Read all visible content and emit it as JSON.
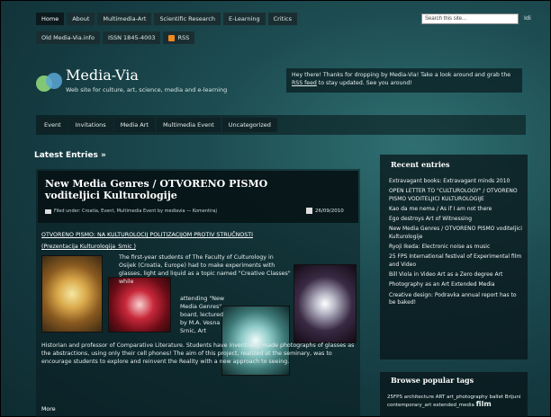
{
  "topnav": [
    "Home",
    "About",
    "Multimedia-Art",
    "Scientific Research",
    "E-Learning",
    "Critics"
  ],
  "subnav": {
    "items": [
      "Old Media-Via.info",
      "ISSN 1845-4003"
    ],
    "rss": "RSS"
  },
  "search": {
    "placeholder": "Search this site...",
    "go": "Idi"
  },
  "header": {
    "title": "Media-Via",
    "description": "Web site for culture, art, science, media and e-learning",
    "welcome_before": "Hey there! Thanks for dropping by Media-Via! Take a look around and grab the ",
    "welcome_link": "RSS feed",
    "welcome_after": " to stay updated. See you around!"
  },
  "catnav": [
    "Event",
    "Invitations",
    "Media Art",
    "Multimedia Event",
    "Uncategorized"
  ],
  "main": {
    "heading": "Latest Entries »",
    "post": {
      "title": "New Media Genres / OTVORENO PISMO voditeljici Kulturologije",
      "filed": "Filed under: Croatia, Event, Multimedia Event by mediavia — Komentiraj",
      "date": "26/09/2010",
      "subtitle1": "OTVORENO PISMO: NA KULTUROLOCIJ POLITIZACIJOM PROTIV STRUČNOSTI",
      "subtitle2": "(Prezentacija Kulturologija_Smic )",
      "para1": "The first-year students of The Faculty of Culturology in Osijek (Croatia, Europe) had to make experiments with glasses, light and liquid as a topic named \"Creative Classes\" while",
      "para2": "attending \"New Media Genres\" board, lectured by M.A. Vesna Srnic, Art",
      "para3": "Historian and professor of Comparative Literature. Students have inventively made photographs of glasses as the abstractions, using only their cell phones! The aim of this project, realized at the seminary, was to encourage students to explore and reinvent the Reality with a new approach to seeing.",
      "more": "More"
    }
  },
  "sidebar": {
    "recent_title": "Recent entries",
    "recent": [
      "Extravagant books: Extravagant minds 2010",
      "OPEN LETTER TO \"CULTUROLOGY\" / OTVORENO PISMO VODITELJICI KULTUROLOGIJE",
      "Kao da me nema / As if I am not there",
      "Ego destroys Art of Witnessing",
      "New Media Genres / OTVORENO PISMO voditeljici Kulturologije",
      "Ryoji Ikeda: Electronic noise as music",
      "25 FPS International festival of Experimental film and Video",
      "Bill Viola in Video Art as a Zero degree Art",
      "Photography as an Art Extended Media",
      "Creative design: Podravka annual report has to be baked!"
    ],
    "tags_title": "Browse popular tags",
    "tags_text": "25FPS architecture ART art_photography ballet Brijuni contemporary_art extended_media",
    "tags_big": "film"
  }
}
